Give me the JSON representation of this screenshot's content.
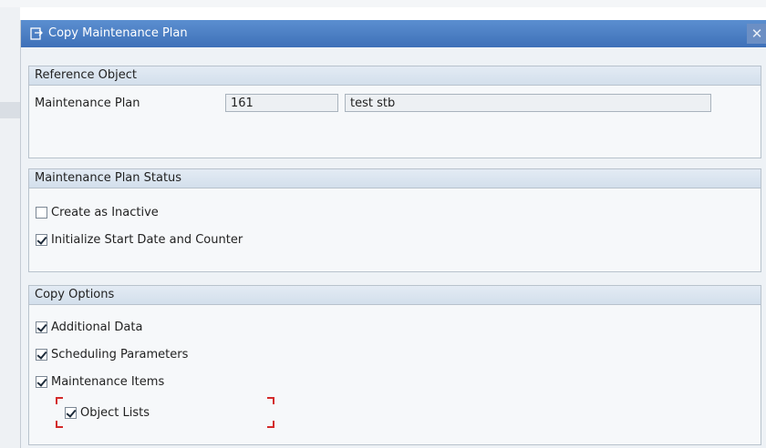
{
  "dialog": {
    "title": "Copy Maintenance Plan",
    "title_icon": "copy-icon",
    "close_icon": "close-icon",
    "close_glyph": "✕"
  },
  "reference_object": {
    "header": "Reference Object",
    "plan_label": "Maintenance Plan",
    "plan_value": "161",
    "plan_description": "test stb"
  },
  "plan_status": {
    "header": "Maintenance Plan Status",
    "options": [
      {
        "label": "Create as Inactive",
        "checked": false
      },
      {
        "label": "Initialize Start Date and Counter",
        "checked": true
      }
    ]
  },
  "copy_options": {
    "header": "Copy Options",
    "options": [
      {
        "label": "Additional Data",
        "checked": true
      },
      {
        "label": "Scheduling Parameters",
        "checked": true
      },
      {
        "label": "Maintenance Items",
        "checked": true
      },
      {
        "label": "Object Lists",
        "checked": true
      }
    ]
  },
  "colors": {
    "title_bar": "#4a7fc4",
    "group_header": "#d9e4f0",
    "focus_marker": "#d32a2a"
  }
}
